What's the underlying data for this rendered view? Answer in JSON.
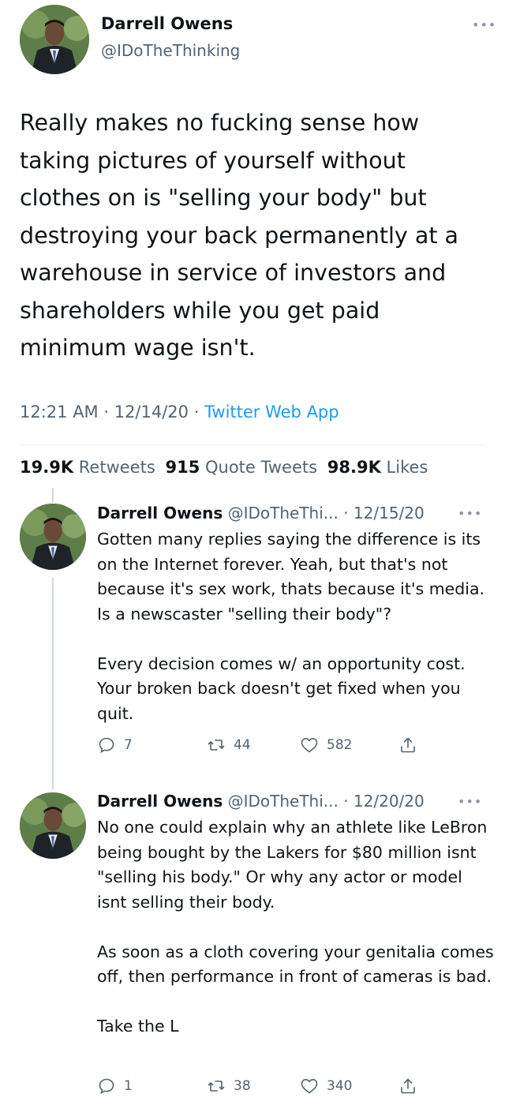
{
  "main_tweet": {
    "author_name": "Darrell Owens",
    "handle": "@IDoTheThinking",
    "text": "Really makes no fucking sense how taking pictures of yourself without clothes on is \"selling your body\" but destroying your back permanently at a warehouse in service of investors and shareholders while you get paid minimum wage isn't.",
    "timestamp": "12:21 AM · 12/14/20 · ",
    "source": "Twitter Web App",
    "stats": {
      "retweets_count": "19.9K",
      "retweets_label": "Retweets",
      "quotes_count": "915",
      "quotes_label": "Quote Tweets",
      "likes_count": "98.9K",
      "likes_label": "Likes"
    },
    "more_icon": "ellipsis-icon"
  },
  "replies": [
    {
      "author_name": "Darrell Owens",
      "meta": "@IDoTheThi... · 12/15/20",
      "text": "Gotten many replies saying the difference is its on the Internet forever. Yeah, but that's not because it's sex work, thats because it's media. Is a newscaster \"selling their body\"?\n\nEvery decision comes w/ an opportunity cost. Your broken back doesn't get fixed when you quit.",
      "reply_count": "7",
      "retweet_count": "44",
      "like_count": "582"
    },
    {
      "author_name": "Darrell Owens",
      "meta": "@IDoTheThi... · 12/20/20",
      "text": "No one could explain why an athlete like LeBron being bought by the Lakers for $80 million isnt \"selling his body.\" Or why any actor or model isnt selling their body.\n\nAs soon as a cloth covering your genitalia comes off, then performance in front of cameras is bad.\n\nTake the L",
      "reply_count": "1",
      "retweet_count": "38",
      "like_count": "340"
    }
  ],
  "colors": {
    "link": "#1d9bf0",
    "muted": "#536471",
    "text": "#0f1419"
  }
}
